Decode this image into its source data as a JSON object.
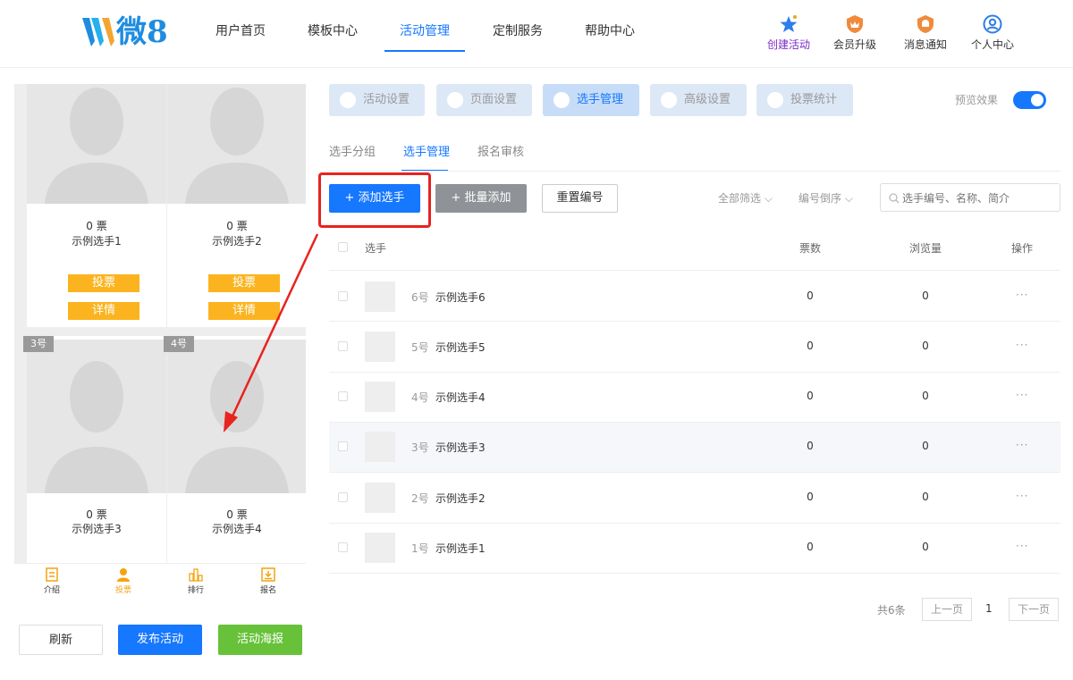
{
  "header": {
    "logo_text": "微8",
    "nav": [
      "用户首页",
      "模板中心",
      "活动管理",
      "定制服务",
      "帮助中心"
    ],
    "actions": [
      "创建活动",
      "会员升级",
      "消息通知",
      "个人中心"
    ]
  },
  "preview": {
    "cards": [
      {
        "votes": "0 票",
        "name": "示例选手1",
        "vote_btn": "投票",
        "detail_btn": "详情"
      },
      {
        "votes": "0 票",
        "name": "示例选手2",
        "vote_btn": "投票",
        "detail_btn": "详情"
      },
      {
        "tag": "3号",
        "votes": "0 票",
        "name": "示例选手3"
      },
      {
        "tag": "4号",
        "votes": "0 票",
        "name": "示例选手4"
      }
    ],
    "tabbar": [
      "介绍",
      "投票",
      "排行",
      "报名"
    ]
  },
  "bottom_buttons": {
    "refresh": "刷新",
    "publish": "发布活动",
    "poster": "活动海报"
  },
  "settings_tabs": [
    "活动设置",
    "页面设置",
    "选手管理",
    "高级设置",
    "投票统计"
  ],
  "preview_toggle": "预览效果",
  "sub_tabs": [
    "选手分组",
    "选手管理",
    "报名审核"
  ],
  "toolbar": {
    "add": "+ 添加选手",
    "batch_add": "+ 批量添加",
    "renumber": "重置编号",
    "filter": "全部筛选",
    "sort": "编号倒序",
    "search_placeholder": "选手编号、名称、简介"
  },
  "table": {
    "headers": {
      "player": "选手",
      "votes": "票数",
      "views": "浏览量",
      "ops": "操作"
    },
    "rows": [
      {
        "no": "6号",
        "name": "示例选手6",
        "votes": "0",
        "views": "0",
        "ops": "···"
      },
      {
        "no": "5号",
        "name": "示例选手5",
        "votes": "0",
        "views": "0",
        "ops": "···"
      },
      {
        "no": "4号",
        "name": "示例选手4",
        "votes": "0",
        "views": "0",
        "ops": "···"
      },
      {
        "no": "3号",
        "name": "示例选手3",
        "votes": "0",
        "views": "0",
        "ops": "···"
      },
      {
        "no": "2号",
        "name": "示例选手2",
        "votes": "0",
        "views": "0",
        "ops": "···"
      },
      {
        "no": "1号",
        "name": "示例选手1",
        "votes": "0",
        "views": "0",
        "ops": "···"
      }
    ]
  },
  "pagination": {
    "total": "共6条",
    "prev": "上一页",
    "page": "1",
    "next": "下一页"
  },
  "colors": {
    "primary": "#1677ff",
    "vote": "#fbb420",
    "poster": "#67c23a",
    "annotation": "#e8231f"
  }
}
